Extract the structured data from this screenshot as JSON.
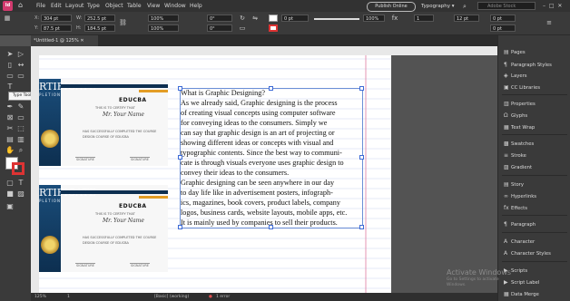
{
  "menubar": {
    "logo": "Id",
    "items": [
      "File",
      "Edit",
      "Layout",
      "Type",
      "Object",
      "Table",
      "View",
      "Window",
      "Help"
    ],
    "publish_label": "Publish Online",
    "workspace": "Typography",
    "stock_placeholder": "Adobe Stock"
  },
  "control": {
    "x": "304 pt",
    "y": "87.5 pt",
    "w": "252.5 pt",
    "h": "184.5 pt",
    "scale_x": "100%",
    "scale_y": "100%",
    "angle": "0°",
    "shear": "0°",
    "stroke_weight": "0 pt",
    "opacity": "100%",
    "gutter_a": "1",
    "gutter_b": "12 pt",
    "ref_a": "0 pt",
    "ref_b": "0 pt"
  },
  "document": {
    "tab_label": "*Untitled-1 @ 125%"
  },
  "tooltip": "Type Tool (T)",
  "certificate": {
    "title": "RTIFICATE",
    "subtitle": "PLETION",
    "brand": "EDUCBA",
    "certify": "THIS IS TO CERTIFY THAT",
    "name": "Mr. Your Name",
    "line1": "HAS SUCCESSFULLY COMPLETED THE COURSE",
    "line2": "DESIGN COURSE OF EDUCBA",
    "sig1": "SIGNATURE",
    "sig2": "SIGNATURE"
  },
  "text_frame": {
    "lines": [
      "What is Graphic Designing?",
      "As we already said, Graphic designing is the process",
      "of creating visual concepts using computer software",
      "for conveying ideas to the consumers. Simply we",
      "can say that graphic design is an art of projecting or",
      "showing different ideas or concepts with visual and",
      "typographic contents. Since the best way to communi-",
      "cate is through visuals everyone uses graphic design to",
      "convey their ideas to the consumers.",
      "Graphic designing can be seen anywhere in our day",
      "to day life like in advertisement posters, infograph-",
      "ics, magazines, book covers, product labels, company",
      "logos, business cards, website layouts, mobile apps, etc.",
      "It is mainly used by companies to sell their products."
    ]
  },
  "panels": [
    {
      "icon": "pages-icon",
      "glyph": "▤",
      "label": "Pages"
    },
    {
      "icon": "paragraph-styles-icon",
      "glyph": "¶",
      "label": "Paragraph Styles"
    },
    {
      "icon": "layers-icon",
      "glyph": "◈",
      "label": "Layers"
    },
    {
      "icon": "cc-libraries-icon",
      "glyph": "▣",
      "label": "CC Libraries"
    },
    {
      "icon": "properties-icon",
      "glyph": "▥",
      "label": "Properties"
    },
    {
      "icon": "glyphs-icon",
      "glyph": "Ω",
      "label": "Glyphs"
    },
    {
      "icon": "text-wrap-icon",
      "glyph": "▦",
      "label": "Text Wrap"
    },
    {
      "icon": "swatches-icon",
      "glyph": "▩",
      "label": "Swatches"
    },
    {
      "icon": "stroke-icon",
      "glyph": "≡",
      "label": "Stroke"
    },
    {
      "icon": "gradient-icon",
      "glyph": "▨",
      "label": "Gradient"
    },
    {
      "icon": "story-icon",
      "glyph": "▤",
      "label": "Story"
    },
    {
      "icon": "hyperlinks-icon",
      "glyph": "∞",
      "label": "Hyperlinks"
    },
    {
      "icon": "effects-icon",
      "glyph": "fx",
      "label": "Effects"
    },
    {
      "icon": "paragraph-icon",
      "glyph": "¶",
      "label": "Paragraph"
    },
    {
      "icon": "character-icon",
      "glyph": "A",
      "label": "Character"
    },
    {
      "icon": "character-styles-icon",
      "glyph": "A",
      "label": "Character Styles"
    },
    {
      "icon": "scripts-icon",
      "glyph": "▶",
      "label": "Scripts"
    },
    {
      "icon": "script-label-icon",
      "glyph": "▶",
      "label": "Script Label"
    },
    {
      "icon": "data-merge-icon",
      "glyph": "▦",
      "label": "Data Merge"
    }
  ],
  "status": {
    "zoom": "125%",
    "page": "1",
    "profile": "[Basic] (working)",
    "errors": "1 error"
  },
  "watermark": {
    "title": "Activate Windows",
    "subtitle": "Go to Settings to activate Windows."
  }
}
